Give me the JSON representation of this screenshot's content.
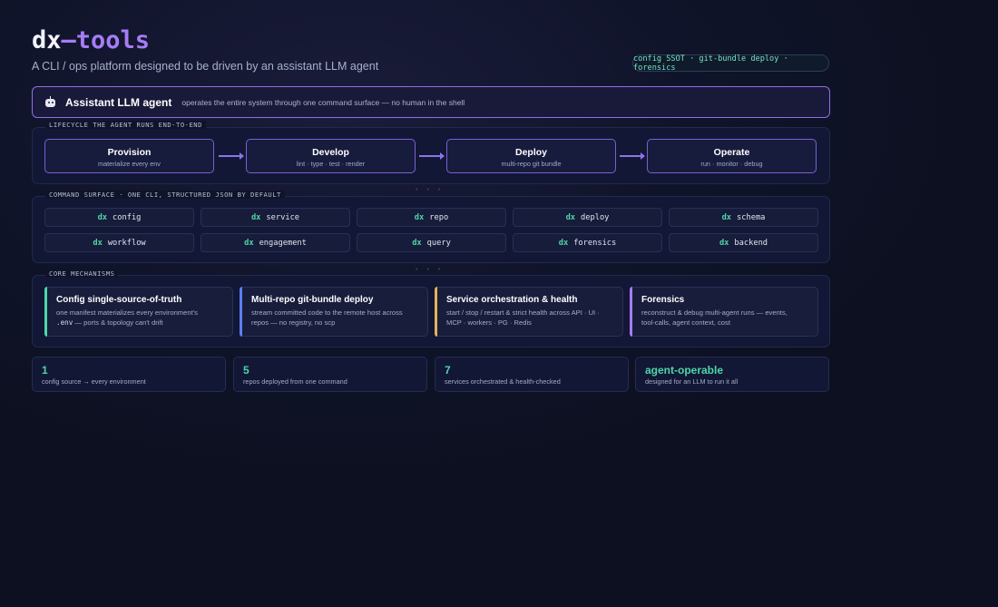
{
  "header": {
    "title_part1": "dx",
    "title_part2": "–tools",
    "subtitle": "A CLI / ops platform designed to be driven by an assistant LLM agent",
    "pill": "config SSOT · git-bundle deploy · forensics"
  },
  "agent": {
    "icon": "robot-icon",
    "title": "Assistant LLM agent",
    "description": "operates the entire system through one command surface — no human in the shell"
  },
  "lifecycle": {
    "label": "LIFECYCLE THE AGENT RUNS END-TO-END",
    "stages": [
      {
        "name": "Provision",
        "desc": "materialize every env"
      },
      {
        "name": "Develop",
        "desc": "lint · type · test · render"
      },
      {
        "name": "Deploy",
        "desc": "multi-repo git bundle"
      },
      {
        "name": "Operate",
        "desc": "run · monitor · debug"
      }
    ]
  },
  "commands": {
    "label": "COMMAND SURFACE · ONE CLI, STRUCTURED JSON BY DEFAULT",
    "prefix": "dx",
    "items": [
      "config",
      "service",
      "repo",
      "deploy",
      "schema",
      "workflow",
      "engagement",
      "query",
      "forensics",
      "backend"
    ]
  },
  "mechanisms": {
    "label": "CORE MECHANISMS",
    "items": [
      {
        "title": "Config single-source-of-truth",
        "desc_a": "one manifest materializes every environment's",
        "desc_b_code": ".env",
        "desc_b": " — ports & topology can't drift",
        "accent": "#4fd6a8"
      },
      {
        "title": "Multi-repo git-bundle deploy",
        "desc_a": "stream committed code to the remote host across",
        "desc_b_code": "",
        "desc_b": "repos — no registry, no scp",
        "accent": "#5b7ff0"
      },
      {
        "title": "Service orchestration & health",
        "desc_a": "start / stop / restart & strict health across API · UI ·",
        "desc_b_code": "",
        "desc_b": "MCP · workers · PG · Redis",
        "accent": "#e0b35a"
      },
      {
        "title": "Forensics",
        "desc_a": "reconstruct & debug multi-agent runs — events,",
        "desc_b_code": "",
        "desc_b": "tool-calls, agent context, cost",
        "accent": "#a67cf6"
      }
    ]
  },
  "stats": [
    {
      "value": "1",
      "label": "config source → every environment"
    },
    {
      "value": "5",
      "label": "repos deployed from one command"
    },
    {
      "value": "7",
      "label": "services orchestrated & health-checked"
    },
    {
      "value": "agent-operable",
      "label": "designed for an LLM to run it all"
    }
  ]
}
